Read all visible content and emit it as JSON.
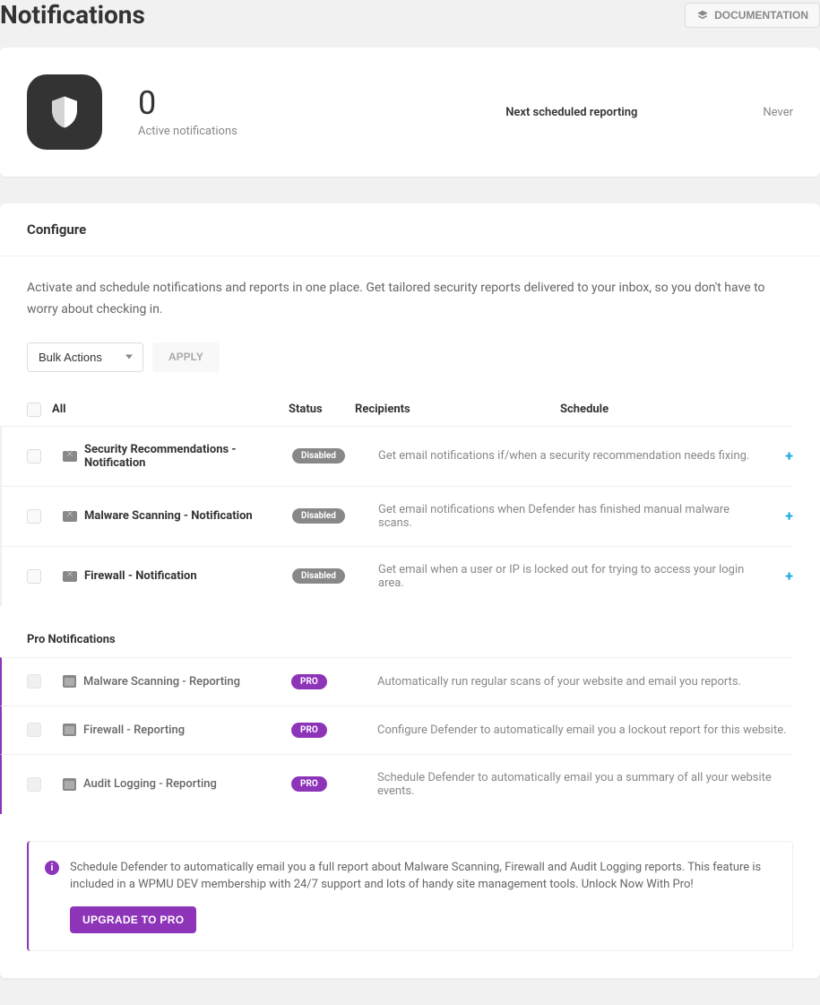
{
  "header": {
    "title": "Notifications",
    "doc_button": "DOCUMENTATION"
  },
  "summary": {
    "active_count": "0",
    "active_label": "Active notifications",
    "next_label": "Next scheduled reporting",
    "next_value": "Never"
  },
  "configure": {
    "heading": "Configure",
    "intro": "Activate and schedule notifications and reports in one place. Get tailored security reports delivered to your inbox, so you don't have to worry about checking in.",
    "bulk_placeholder": "Bulk Actions",
    "apply_label": "APPLY",
    "columns": {
      "all": "All",
      "status": "Status",
      "recipients": "Recipients",
      "schedule": "Schedule"
    },
    "rows": [
      {
        "title": "Security Recommendations - Notification",
        "status": "Disabled",
        "desc": "Get email notifications if/when a security recommendation needs fixing."
      },
      {
        "title": "Malware Scanning - Notification",
        "status": "Disabled",
        "desc": "Get email notifications when Defender has finished manual malware scans."
      },
      {
        "title": "Firewall - Notification",
        "status": "Disabled",
        "desc": "Get email when a user or IP is locked out for trying to access your login area."
      }
    ],
    "pro_heading": "Pro Notifications",
    "pro_rows": [
      {
        "title": "Malware Scanning - Reporting",
        "status": "PRO",
        "desc": "Automatically run regular scans of your website and email you reports."
      },
      {
        "title": "Firewall - Reporting",
        "status": "PRO",
        "desc": "Configure Defender to automatically email you a lockout report for this website."
      },
      {
        "title": "Audit Logging - Reporting",
        "status": "PRO",
        "desc": "Schedule Defender to automatically email you a summary of all your website events."
      }
    ],
    "upsell": {
      "text": "Schedule Defender to automatically email you a full report about Malware Scanning, Firewall and Audit Logging reports. This feature is included in a WPMU DEV membership with 24/7 support and lots of handy site management tools. Unlock Now With Pro!",
      "button": "UPGRADE TO PRO"
    }
  }
}
